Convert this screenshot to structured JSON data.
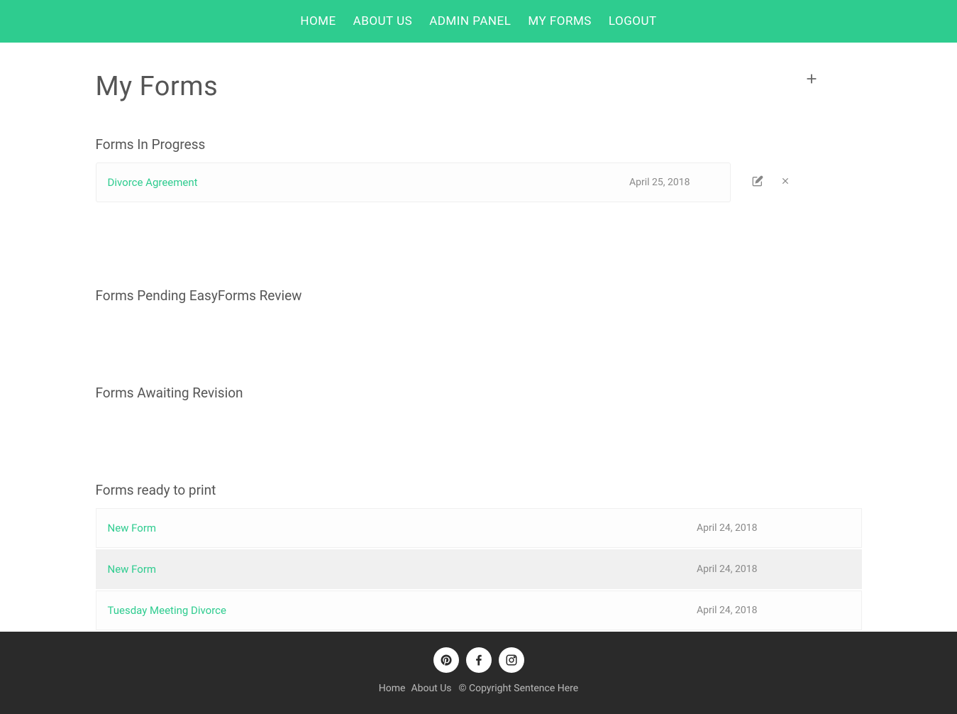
{
  "nav": {
    "items": [
      "HOME",
      "ABOUT US",
      "ADMIN PANEL",
      "MY FORMS",
      "LOGOUT"
    ]
  },
  "page": {
    "title": "My Forms"
  },
  "sections": {
    "in_progress": {
      "title": "Forms In Progress",
      "items": [
        {
          "name": "Divorce Agreement",
          "date": "April 25, 2018"
        }
      ]
    },
    "pending_review": {
      "title": "Forms Pending EasyForms Review",
      "items": []
    },
    "awaiting_revision": {
      "title": "Forms Awaiting Revision",
      "items": []
    },
    "ready_to_print": {
      "title": "Forms ready to print",
      "items": [
        {
          "name": "New Form",
          "date": "April 24, 2018"
        },
        {
          "name": "New Form",
          "date": "April 24, 2018"
        },
        {
          "name": "Tuesday Meeting Divorce",
          "date": "April 24, 2018"
        }
      ]
    }
  },
  "footer": {
    "links": [
      "Home",
      "About Us"
    ],
    "copyright": "© Copyright Sentence Here"
  }
}
